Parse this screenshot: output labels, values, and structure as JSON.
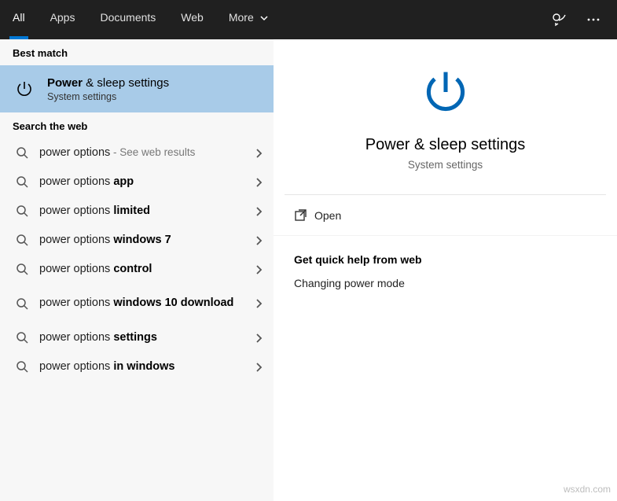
{
  "topbar": {
    "tabs": [
      {
        "label": "All",
        "active": true
      },
      {
        "label": "Apps",
        "active": false
      },
      {
        "label": "Documents",
        "active": false
      },
      {
        "label": "Web",
        "active": false
      },
      {
        "label": "More",
        "active": false,
        "dropdown": true
      }
    ]
  },
  "left": {
    "best_header": "Best match",
    "best": {
      "title_prefix": "Power",
      "title_rest": " & sleep settings",
      "subtitle": "System settings"
    },
    "web_header": "Search the web",
    "web": [
      {
        "plain": "power options",
        "bold": "",
        "hint": " - See web results"
      },
      {
        "plain": "power options ",
        "bold": "app",
        "hint": ""
      },
      {
        "plain": "power options ",
        "bold": "limited",
        "hint": ""
      },
      {
        "plain": "power options ",
        "bold": "windows 7",
        "hint": ""
      },
      {
        "plain": "power options ",
        "bold": "control",
        "hint": ""
      },
      {
        "plain": "power options ",
        "bold": "windows 10 download",
        "hint": "",
        "tall": true
      },
      {
        "plain": "power options ",
        "bold": "settings",
        "hint": ""
      },
      {
        "plain": "power options ",
        "bold": "in windows",
        "hint": ""
      }
    ]
  },
  "right": {
    "title": "Power & sleep settings",
    "subtitle": "System settings",
    "open_label": "Open",
    "help_header": "Get quick help from web",
    "help_links": [
      "Changing power mode"
    ]
  },
  "watermark": "wsxdn.com"
}
